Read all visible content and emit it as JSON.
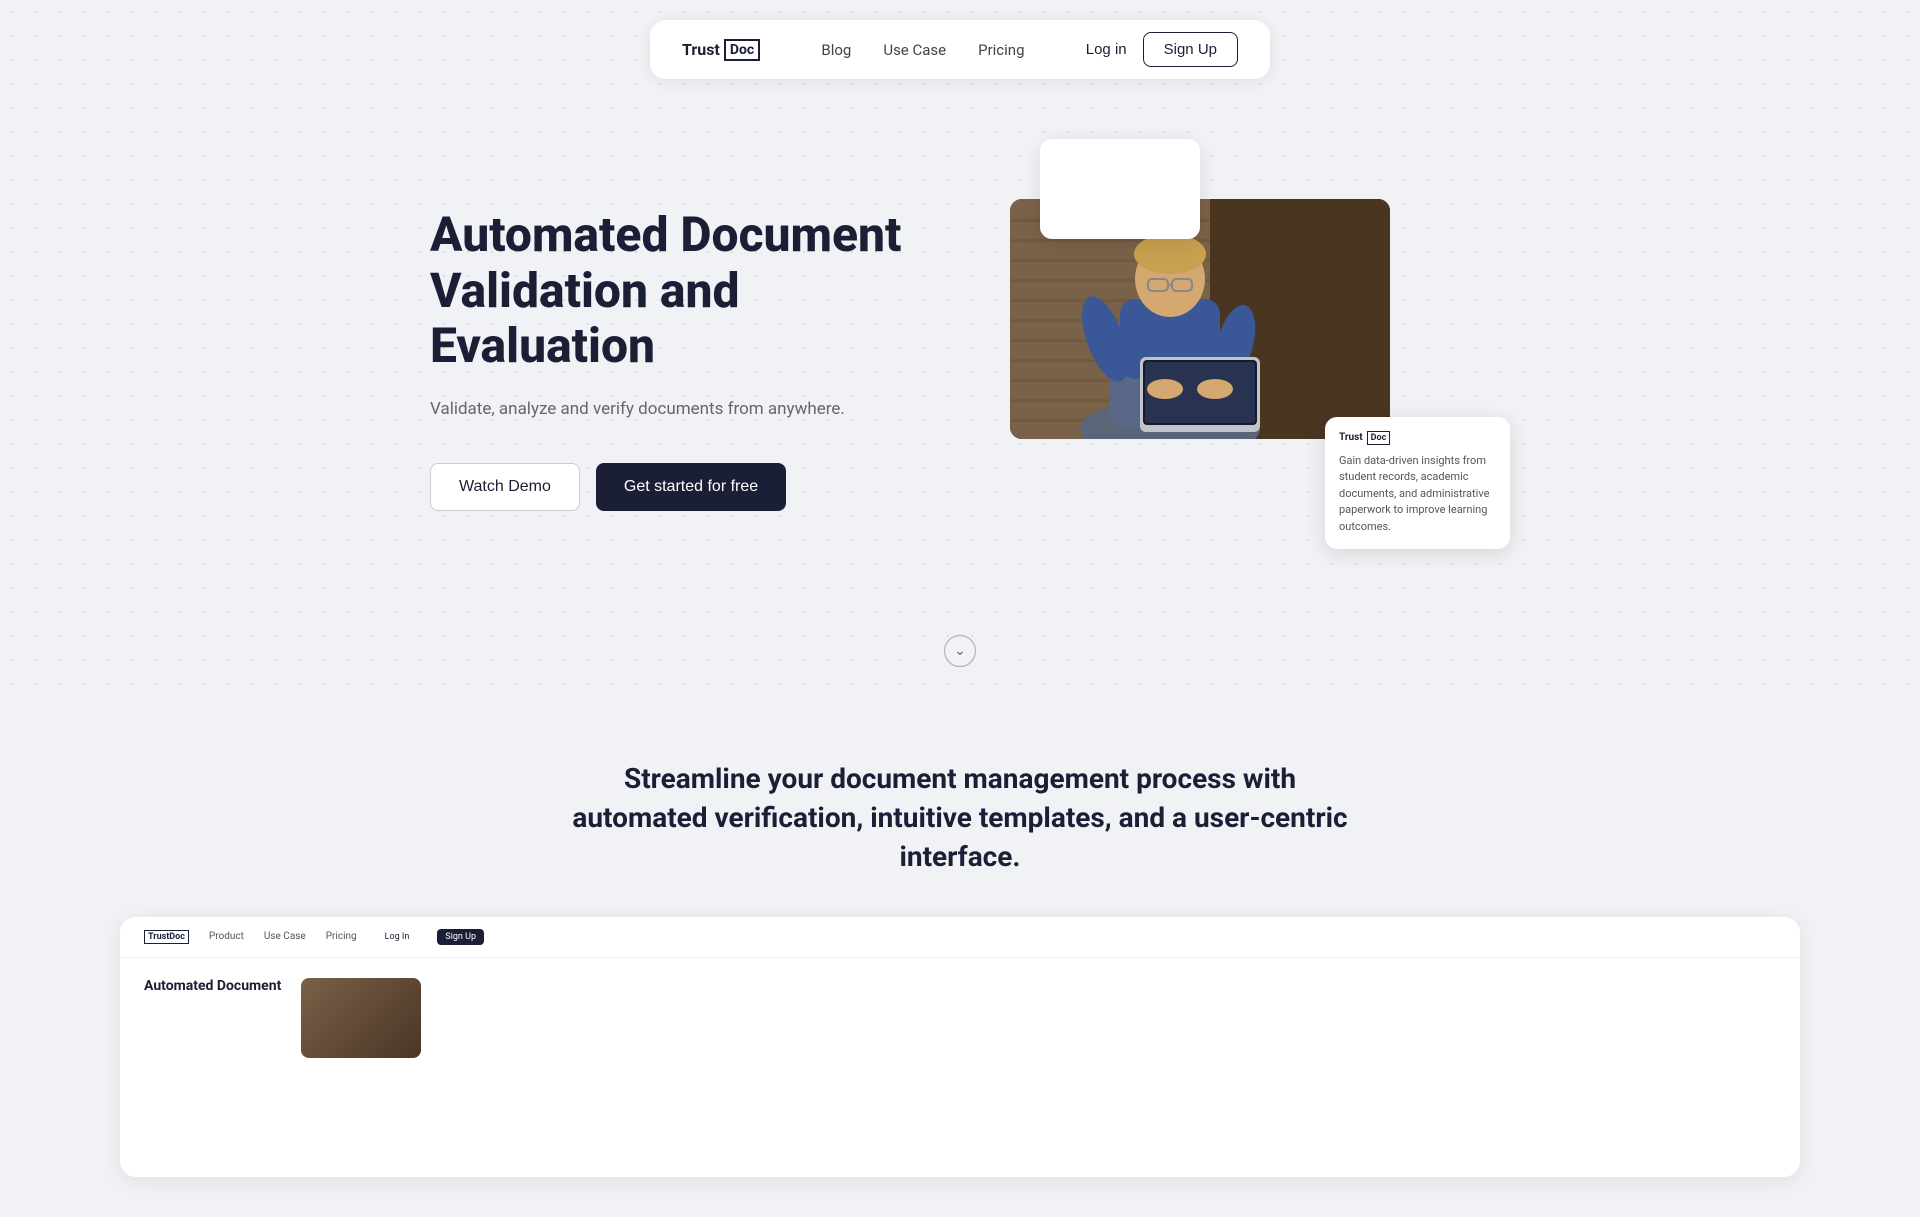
{
  "navbar": {
    "logo_trust": "Trust",
    "logo_doc": "Doc",
    "nav_items": [
      {
        "label": "Blog",
        "id": "blog"
      },
      {
        "label": "Use Case",
        "id": "use-case"
      },
      {
        "label": "Pricing",
        "id": "pricing"
      }
    ],
    "login_label": "Log in",
    "signup_label": "Sign Up"
  },
  "hero": {
    "title": "Automated Document Validation and Evaluation",
    "subtitle": "Validate, analyze and verify documents from anywhere.",
    "watch_demo_label": "Watch Demo",
    "get_started_label": "Get started for free"
  },
  "tooltip": {
    "logo_trust": "Trust",
    "logo_doc": "Doc",
    "text": "Gain data-driven insights from student records, academic documents, and administrative paperwork to improve learning outcomes."
  },
  "scroll_chevron": "∨",
  "features": {
    "title": "Streamline your document management process with automated verification, intuitive templates, and a user-centric interface.",
    "preview_nav": {
      "logo": "TrustDoc",
      "links": [
        "Product",
        "Use Case",
        "Pricing"
      ],
      "login": "Log In",
      "signup": "Sign Up"
    },
    "preview_title": "Automated Document"
  }
}
